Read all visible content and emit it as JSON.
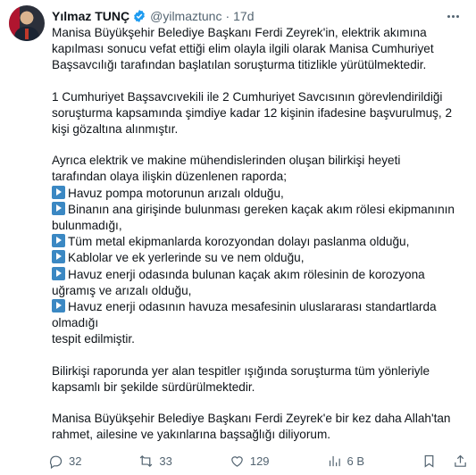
{
  "author": {
    "name": "Yılmaz TUNÇ",
    "handle": "@yilmaztunc",
    "separator": "·",
    "time": "17d"
  },
  "tweet": {
    "paragraphs": [
      [
        {
          "text": "Manisa Büyükşehir Belediye Başkanı Ferdi Zeyrek'in, elektrik akımına"
        },
        {
          "text": "kapılması sonucu vefat ettiği elim olayla ilgili olarak Manisa Cumhuriyet"
        },
        {
          "text": "Başsavcılığı tarafından başlatılan soruşturma titizlikle yürütülmektedir."
        }
      ],
      [
        {
          "text": "1 Cumhuriyet Başsavcıvekili ile 2 Cumhuriyet Savcısının görevlendirildiği"
        },
        {
          "text": "soruşturma kapsamında şimdiye kadar 12 kişinin ifadesine başvurulmuş, 2"
        },
        {
          "text": "kişi gözaltına alınmıştır."
        }
      ],
      [
        {
          "text": "Ayrıca elektrik ve makine mühendislerinden oluşan bilirkişi heyeti"
        },
        {
          "text": "tarafından olaya ilişkin düzenlenen raporda;"
        },
        {
          "emoji": true,
          "text": "Havuz pompa motorunun arızalı olduğu,"
        },
        {
          "emoji": true,
          "text": "Binanın ana girişinde bulunması gereken kaçak akım rölesi ekipmanının"
        },
        {
          "text": "bulunmadığı,"
        },
        {
          "emoji": true,
          "text": "Tüm metal ekipmanlarda korozyondan dolayı paslanma olduğu,"
        },
        {
          "emoji": true,
          "text": "Kablolar ve ek yerlerinde su ve nem olduğu,"
        },
        {
          "emoji": true,
          "text": "Havuz enerji odasında bulunan kaçak akım rölesinin de korozyona"
        },
        {
          "text": "uğramış ve arızalı olduğu,"
        },
        {
          "emoji": true,
          "text": "Havuz enerji odasının havuza mesafesinin uluslararası standartlarda"
        },
        {
          "text": "olmadığı"
        },
        {
          "text": "tespit edilmiştir."
        }
      ],
      [
        {
          "text": "Bilirkişi raporunda yer alan tespitler ışığında soruşturma tüm yönleriyle"
        },
        {
          "text": "kapsamlı bir şekilde sürdürülmektedir."
        }
      ],
      [
        {
          "text": "Manisa Büyükşehir Belediye Başkanı Ferdi Zeyrek'e bir kez daha Allah'tan"
        },
        {
          "text": "rahmet, ailesine ve yakınlarına başsağlığı diliyorum."
        }
      ]
    ]
  },
  "actions": {
    "replies": "32",
    "reposts": "33",
    "likes": "129",
    "views": "6 B"
  },
  "colors": {
    "text": "#0f1419",
    "muted": "#536471",
    "verified": "#1d9bf0",
    "emoji": "#3b88c3"
  },
  "icons": [
    "verified-badge-icon",
    "more-icon",
    "reply-icon",
    "repost-icon",
    "like-icon",
    "views-icon",
    "bookmark-icon",
    "share-icon"
  ]
}
